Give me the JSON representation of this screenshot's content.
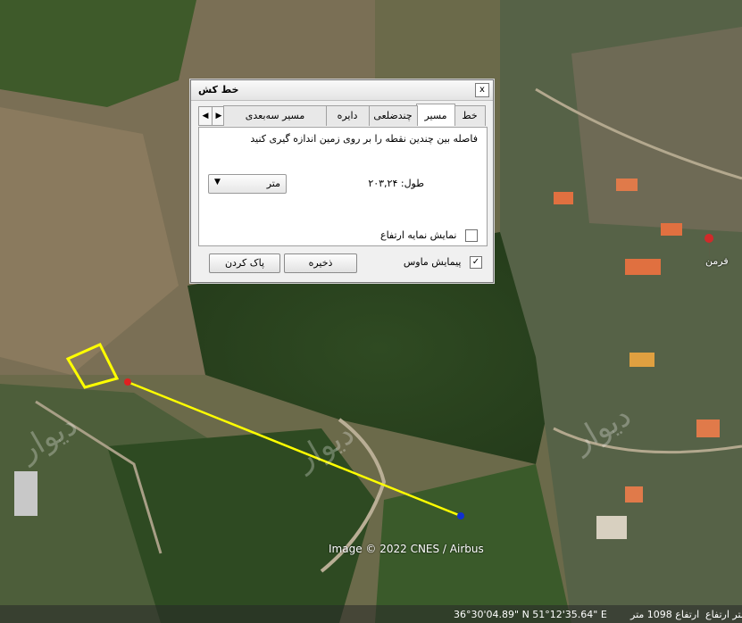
{
  "dialog": {
    "title": "خط کش",
    "close_symbol": "x",
    "tabs": [
      "خط",
      "مسیر",
      "چندضلعی",
      "دایره",
      "مسیر سه‌بعدی"
    ],
    "active_tab": "مسیر",
    "description": "فاصله بین چندین نقطه را بر روی زمین اندازه گیری کنید",
    "length_label": "طول:",
    "length_value": "۲۰۳,۲۴",
    "unit_selected": "متر",
    "show_elevation_label": "نمایش نمایه ارتفاع",
    "mouse_nav_label": "پیمایش ماوس",
    "mouse_nav_check": "✓",
    "save_button": "ذخیره",
    "clear_button": "پاک کردن"
  },
  "map": {
    "credit": "Image © 2022 CNES / Airbus",
    "poi_label": "فرمن",
    "watermark": "دیوار"
  },
  "status_bar": {
    "coords": "36°30'04.89\" N   51°12'35.64\" E",
    "elevation": "ارتفاع 1098 متر",
    "alt_short": "متر ارتفاع"
  },
  "colors": {
    "path": "#ffff00",
    "start_point": "#e02020",
    "end_point": "#1030d0"
  }
}
